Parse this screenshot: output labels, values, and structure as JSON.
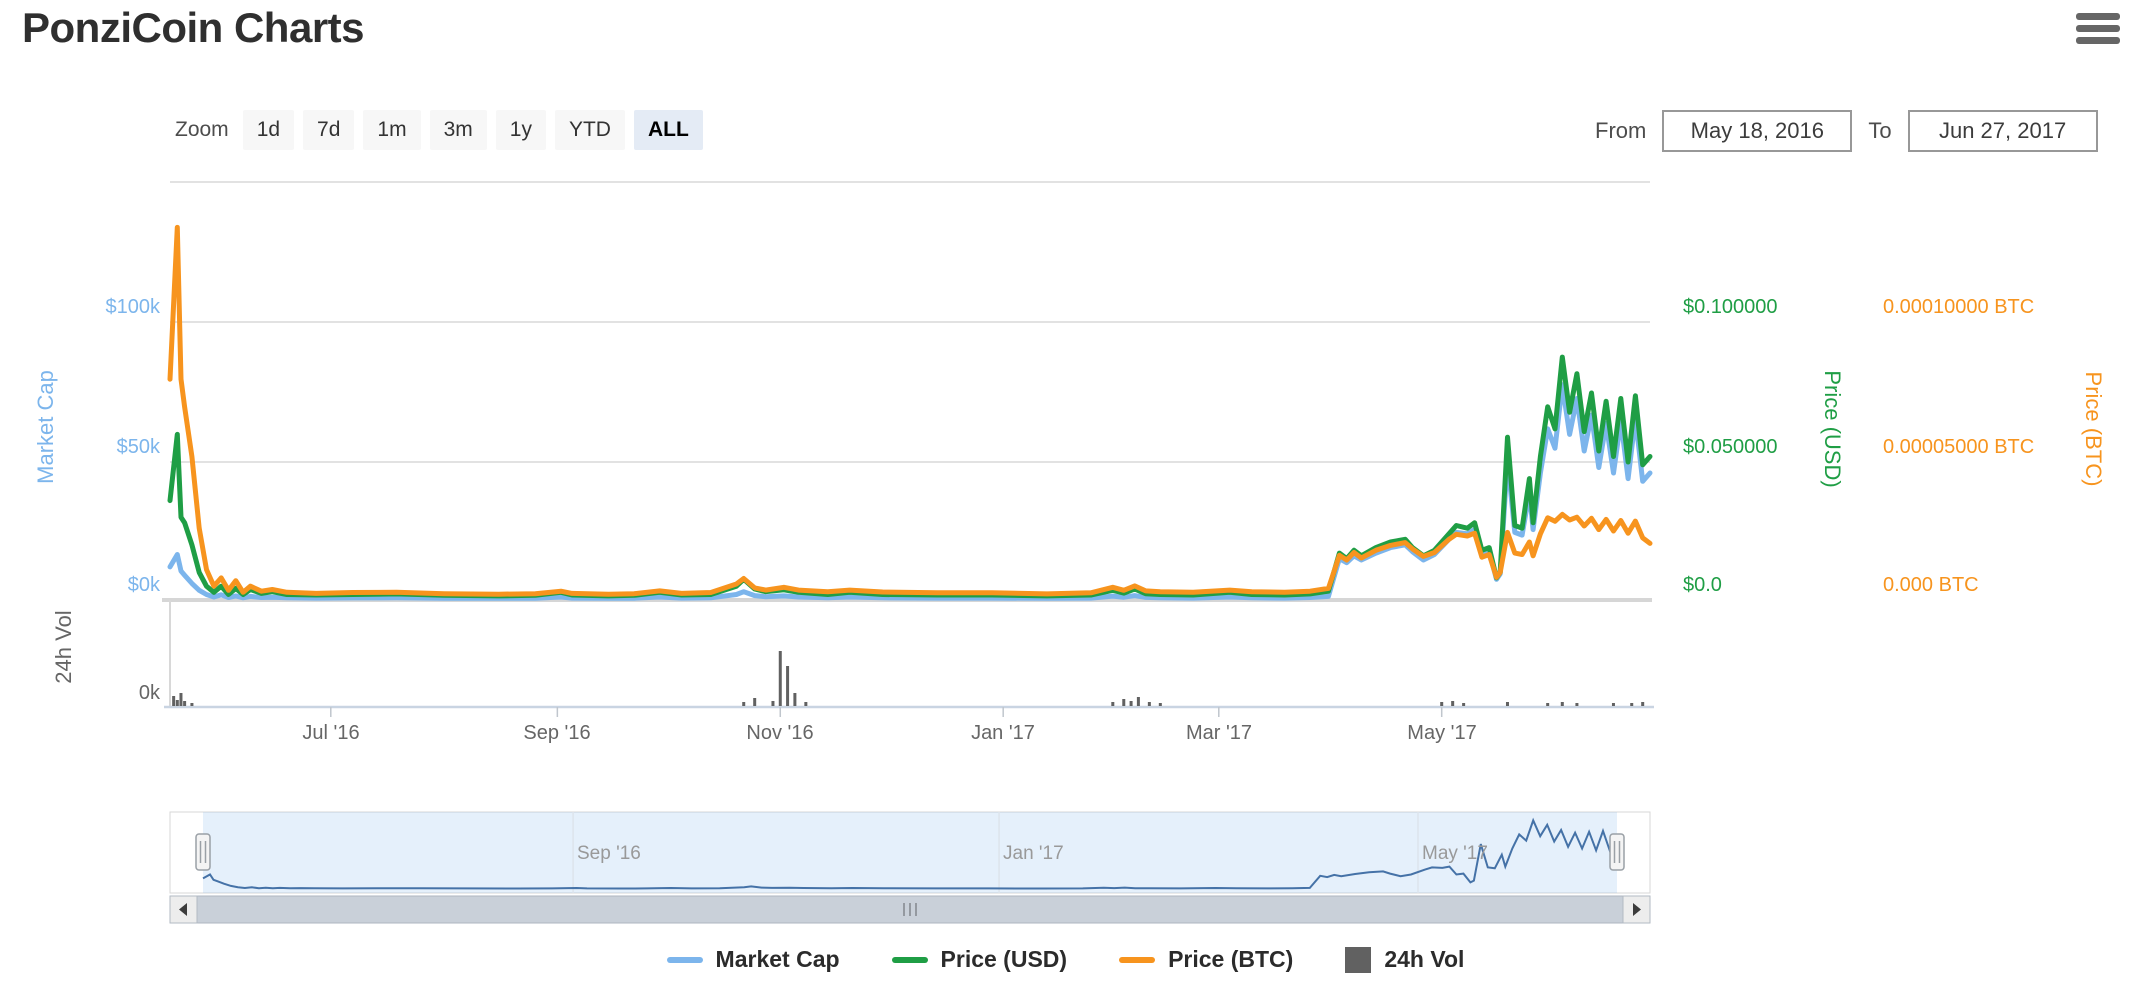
{
  "header": {
    "title": "PonziCoin Charts"
  },
  "range_selector": {
    "zoom_label": "Zoom",
    "buttons": [
      {
        "label": "1d",
        "active": false
      },
      {
        "label": "7d",
        "active": false
      },
      {
        "label": "1m",
        "active": false
      },
      {
        "label": "3m",
        "active": false
      },
      {
        "label": "1y",
        "active": false
      },
      {
        "label": "YTD",
        "active": false
      },
      {
        "label": "ALL",
        "active": true
      }
    ],
    "from_label": "From",
    "from_value": "May 18, 2016",
    "to_label": "To",
    "to_value": "Jun 27, 2017"
  },
  "chart_data": {
    "type": "line",
    "title": "PonziCoin Charts",
    "x_axis": {
      "start": "May 18, 2016",
      "end": "Jun 27, 2017",
      "unit": "days_from_start",
      "ticks": [
        {
          "label": "Jul '16",
          "day": 44
        },
        {
          "label": "Sep '16",
          "day": 106
        },
        {
          "label": "Nov '16",
          "day": 167
        },
        {
          "label": "Jan '17",
          "day": 228
        },
        {
          "label": "Mar '17",
          "day": 287
        },
        {
          "label": "May '17",
          "day": 348
        }
      ]
    },
    "y_axes": {
      "market_cap": {
        "title": "Market Cap",
        "color": "#7cb5ec",
        "units_per_gridline": 50000,
        "ticks": [
          "$0k",
          "$50k",
          "$100k"
        ]
      },
      "price_usd": {
        "title": "Price (USD)",
        "color": "#1f9e45",
        "units_per_gridline": 0.05,
        "ticks": [
          "$0.0",
          "$0.050000",
          "$0.100000"
        ]
      },
      "price_btc": {
        "title": "Price (BTC)",
        "color": "#f7941e",
        "units_per_gridline": 5e-05,
        "ticks": [
          "0.000 BTC",
          "0.00005000 BTC",
          "0.00010000 BTC"
        ]
      },
      "volume": {
        "title": "24h Vol",
        "color": "#666666",
        "ticks": [
          "0k"
        ]
      }
    },
    "days": [
      0,
      2,
      3,
      4,
      6,
      8,
      10,
      12,
      14,
      16,
      18,
      20,
      22,
      25,
      28,
      32,
      40,
      50,
      62,
      75,
      90,
      100,
      107,
      110,
      120,
      127,
      134,
      140,
      148,
      155,
      157,
      160,
      163,
      168,
      172,
      180,
      186,
      195,
      210,
      225,
      240,
      252,
      258,
      261,
      264,
      267,
      271,
      280,
      290,
      296,
      305,
      312,
      317,
      320,
      322,
      324,
      326,
      330,
      334,
      338,
      340,
      343,
      346,
      350,
      352,
      355,
      357,
      359,
      361,
      363,
      364,
      366,
      368,
      370,
      372,
      373,
      375,
      377,
      379,
      381,
      383,
      385,
      387,
      389,
      391,
      393,
      395,
      397,
      399,
      401,
      403,
      405
    ],
    "series": [
      {
        "name": "Market Cap",
        "type": "line",
        "axis": "market_cap",
        "color": "#7cb5ec",
        "values": [
          12000,
          16500,
          10500,
          9000,
          6000,
          3500,
          2000,
          1100,
          1900,
          900,
          1500,
          800,
          1300,
          900,
          1000,
          800,
          700,
          750,
          800,
          650,
          600,
          650,
          1100,
          700,
          600,
          650,
          1100,
          700,
          800,
          2000,
          3000,
          1600,
          1200,
          1500,
          1100,
          800,
          1100,
          800,
          700,
          700,
          600,
          700,
          1400,
          1000,
          1600,
          950,
          800,
          700,
          1100,
          800,
          700,
          900,
          1300,
          15000,
          13500,
          16000,
          14500,
          17000,
          19000,
          20000,
          17500,
          14500,
          16500,
          22000,
          24500,
          24000,
          25500,
          16500,
          17500,
          7500,
          9500,
          51000,
          24500,
          23500,
          39000,
          25500,
          46000,
          62000,
          55000,
          78000,
          60000,
          73000,
          54000,
          67000,
          48000,
          64000,
          46000,
          65000,
          44000,
          66000,
          43000,
          46000
        ]
      },
      {
        "name": "Price (USD)",
        "type": "line",
        "axis": "price_usd",
        "color": "#1f9e45",
        "values": [
          0.036,
          0.06,
          0.03,
          0.028,
          0.02,
          0.01,
          0.005,
          0.0028,
          0.005,
          0.002,
          0.0042,
          0.002,
          0.0038,
          0.0024,
          0.003,
          0.002,
          0.0018,
          0.002,
          0.0022,
          0.0017,
          0.0015,
          0.0017,
          0.0028,
          0.0018,
          0.0015,
          0.0017,
          0.0028,
          0.0018,
          0.002,
          0.005,
          0.0075,
          0.004,
          0.003,
          0.0037,
          0.0028,
          0.002,
          0.0028,
          0.002,
          0.0018,
          0.0018,
          0.0015,
          0.0018,
          0.0035,
          0.0025,
          0.004,
          0.0023,
          0.002,
          0.0018,
          0.0028,
          0.002,
          0.0018,
          0.0022,
          0.0032,
          0.017,
          0.015,
          0.018,
          0.016,
          0.019,
          0.021,
          0.022,
          0.019,
          0.016,
          0.018,
          0.024,
          0.027,
          0.026,
          0.028,
          0.018,
          0.019,
          0.008,
          0.01,
          0.059,
          0.027,
          0.026,
          0.044,
          0.028,
          0.052,
          0.07,
          0.062,
          0.088,
          0.068,
          0.082,
          0.061,
          0.075,
          0.054,
          0.072,
          0.052,
          0.073,
          0.05,
          0.074,
          0.049,
          0.052
        ]
      },
      {
        "name": "Price (BTC)",
        "type": "line",
        "axis": "price_btc",
        "color": "#f7941e",
        "values": [
          8e-05,
          0.000135,
          8e-05,
          7e-05,
          5.2e-05,
          2.6e-05,
          1.1e-05,
          5e-06,
          8e-06,
          3.5e-06,
          7e-06,
          2.8e-06,
          5e-06,
          3.2e-06,
          3.8e-06,
          2.8e-06,
          2.4e-06,
          2.7e-06,
          2.8e-06,
          2.3e-06,
          2.1e-06,
          2.3e-06,
          3.2e-06,
          2.4e-06,
          2.1e-06,
          2.3e-06,
          3.3e-06,
          2.4e-06,
          2.7e-06,
          5.8e-06,
          7.8e-06,
          4.4e-06,
          3.6e-06,
          4.6e-06,
          3.6e-06,
          3e-06,
          3.6e-06,
          2.9e-06,
          2.6e-06,
          2.6e-06,
          2.2e-06,
          2.6e-06,
          4.6e-06,
          3.5e-06,
          5.1e-06,
          3.3e-06,
          3e-06,
          2.8e-06,
          3.6e-06,
          3e-06,
          2.8e-06,
          3.2e-06,
          4.2e-06,
          1.62e-05,
          1.45e-05,
          1.72e-05,
          1.52e-05,
          1.8e-05,
          1.98e-05,
          2.08e-05,
          1.85e-05,
          1.58e-05,
          1.72e-05,
          2.2e-05,
          2.38e-05,
          2.32e-05,
          2.42e-05,
          1.55e-05,
          1.65e-05,
          8.2e-06,
          1e-05,
          2.45e-05,
          1.7e-05,
          1.65e-05,
          2.1e-05,
          1.6e-05,
          2.4e-05,
          2.98e-05,
          2.85e-05,
          3.1e-05,
          2.9e-05,
          3e-05,
          2.68e-05,
          2.96e-05,
          2.55e-05,
          2.92e-05,
          2.5e-05,
          2.88e-05,
          2.42e-05,
          2.86e-05,
          2.25e-05,
          2.05e-05
        ]
      },
      {
        "name": "24h Vol",
        "type": "column",
        "axis": "volume",
        "color": "#616161",
        "points_relative_height": [
          [
            1,
            0.1
          ],
          [
            2,
            0.06
          ],
          [
            3,
            0.13
          ],
          [
            4,
            0.05
          ],
          [
            6,
            0.03
          ],
          [
            157,
            0.04
          ],
          [
            160,
            0.08
          ],
          [
            165,
            0.05
          ],
          [
            167,
            0.55
          ],
          [
            169,
            0.4
          ],
          [
            171,
            0.13
          ],
          [
            174,
            0.04
          ],
          [
            258,
            0.04
          ],
          [
            261,
            0.07
          ],
          [
            263,
            0.05
          ],
          [
            265,
            0.09
          ],
          [
            268,
            0.04
          ],
          [
            271,
            0.03
          ],
          [
            348,
            0.04
          ],
          [
            351,
            0.05
          ],
          [
            354,
            0.03
          ],
          [
            366,
            0.04
          ],
          [
            377,
            0.03
          ],
          [
            381,
            0.04
          ],
          [
            385,
            0.03
          ],
          [
            395,
            0.03
          ],
          [
            400,
            0.03
          ],
          [
            403,
            0.04
          ]
        ]
      }
    ],
    "navigator": {
      "line_color": "#4572a7",
      "mask_color": "rgba(124,181,236,0.2)",
      "labels": [
        {
          "label": "Sep '16",
          "day": 106
        },
        {
          "label": "Jan '17",
          "day": 228
        },
        {
          "label": "May '17",
          "day": 348
        }
      ]
    }
  }
}
